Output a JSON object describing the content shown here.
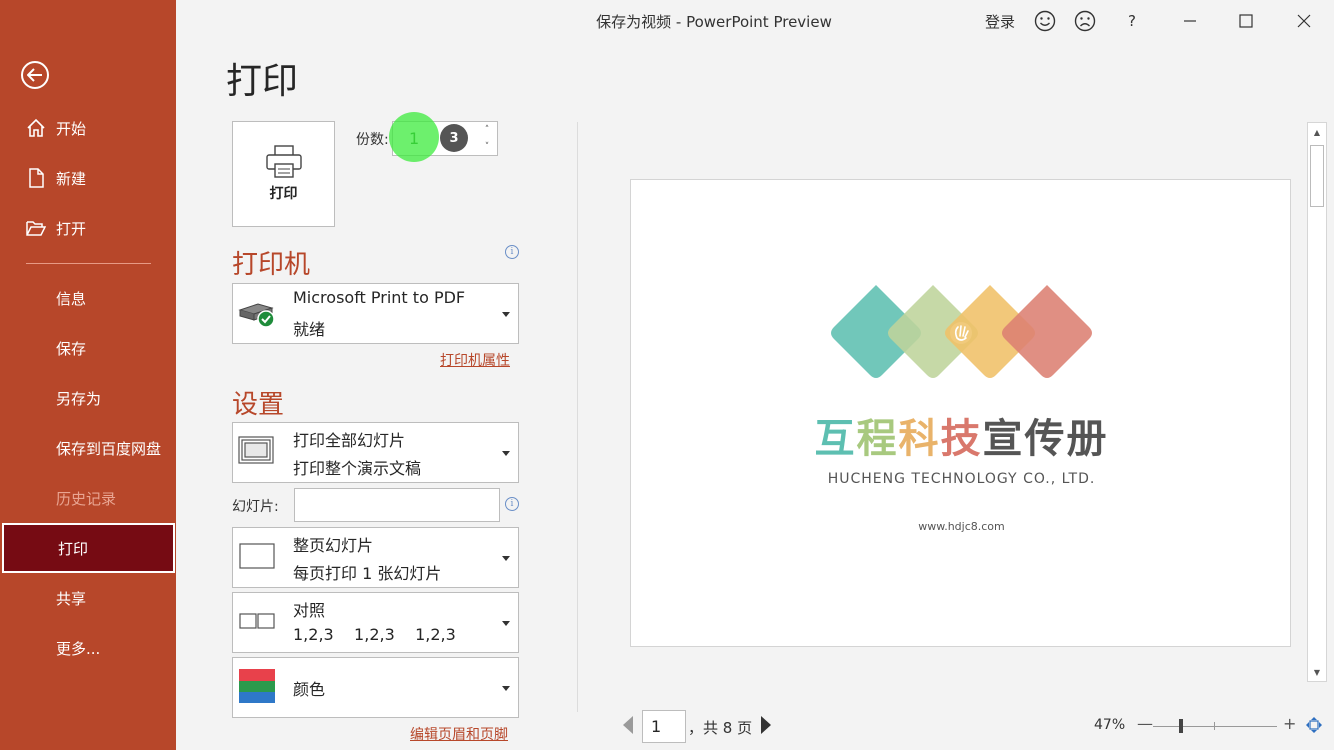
{
  "window": {
    "title": "保存为视频  -  PowerPoint Preview",
    "login": "登录",
    "help": "?"
  },
  "sidebar": {
    "items": [
      {
        "label": "开始",
        "icon": "home-icon"
      },
      {
        "label": "新建",
        "icon": "new-document-icon"
      },
      {
        "label": "打开",
        "icon": "folder-open-icon"
      },
      {
        "label": "信息"
      },
      {
        "label": "保存"
      },
      {
        "label": "另存为"
      },
      {
        "label": "保存到百度网盘"
      },
      {
        "label": "历史记录",
        "disabled": true
      },
      {
        "label": "打印",
        "active": true
      },
      {
        "label": "共享"
      },
      {
        "label": "更多..."
      }
    ]
  },
  "print": {
    "page_title": "打印",
    "print_button": "打印",
    "copies_label": "份数:",
    "copies_value": "1",
    "step_badge": "3",
    "printer_heading": "打印机",
    "printer_name": "Microsoft Print to PDF",
    "printer_status": "就绪",
    "printer_properties": "打印机属性",
    "settings_heading": "设置",
    "range_title": "打印全部幻灯片",
    "range_desc": "打印整个演示文稿",
    "slides_label": "幻灯片:",
    "slides_value": "",
    "layout_title": "整页幻灯片",
    "layout_desc": "每页打印 1 张幻灯片",
    "collate_title": "对照",
    "collate_desc": "1,2,3    1,2,3    1,2,3",
    "color_label": "颜色",
    "edit_header_footer": "编辑页眉和页脚"
  },
  "preview": {
    "slide_title_parts": [
      {
        "text": "互",
        "color": "#5dbfb1"
      },
      {
        "text": "程",
        "color": "#a8c97f"
      },
      {
        "text": "科",
        "color": "#e9b36a"
      },
      {
        "text": "技",
        "color": "#d9786c"
      },
      {
        "text": "宣传册",
        "color": "#555555"
      }
    ],
    "slide_subtitle": "HUCHENG TECHNOLOGY CO., LTD.",
    "slide_url": "www.hdjc8.com",
    "logo_colors": [
      "#5dbfb1",
      "#bed49b",
      "#f0c068",
      "#dc7f72"
    ],
    "current_page": "1",
    "page_total": "，共 8 页",
    "zoom": "47%",
    "zoom_fraction": 0.47
  }
}
